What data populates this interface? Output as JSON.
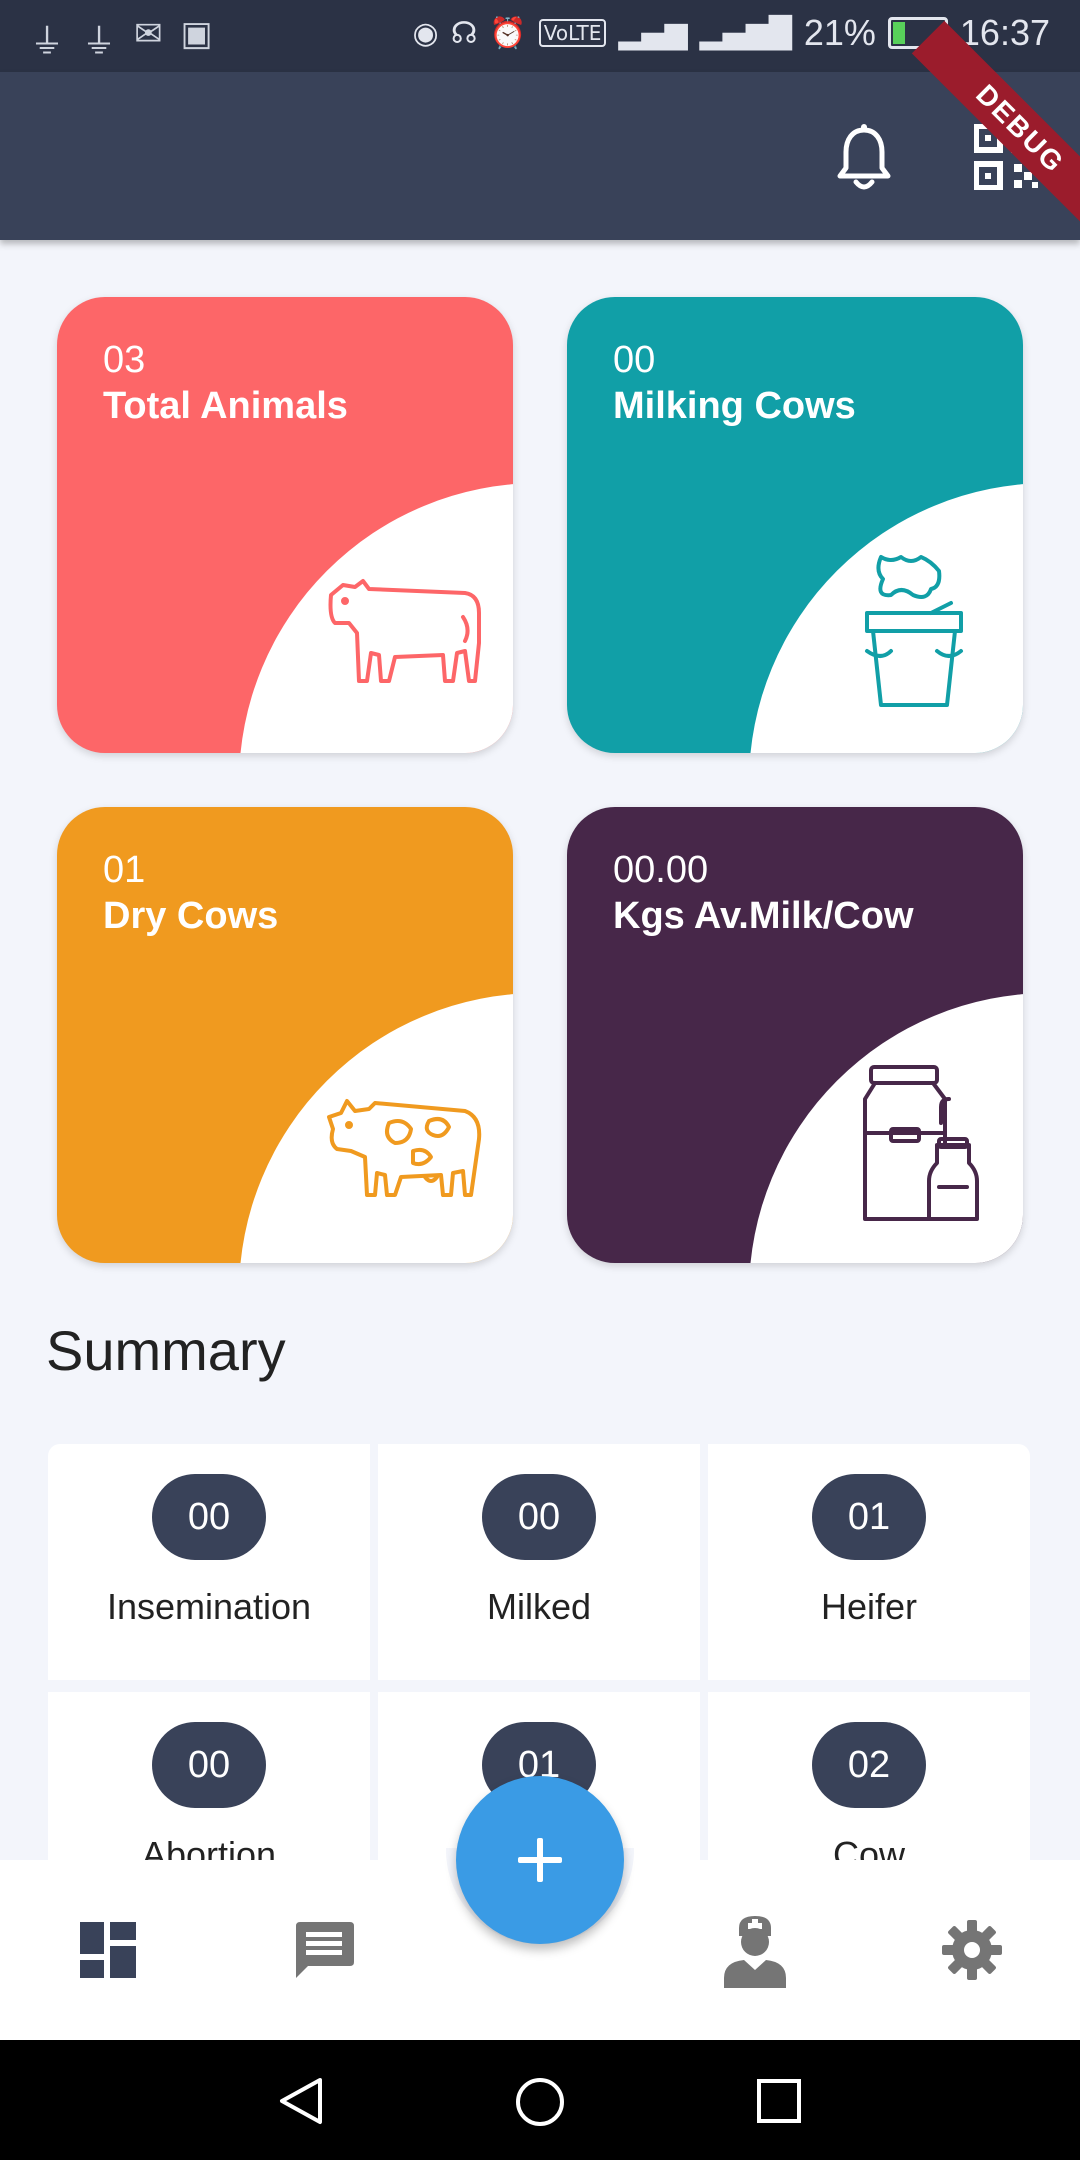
{
  "status_bar": {
    "left_icons": [
      "usb-icon",
      "usb-icon",
      "mail-icon",
      "flipboard-icon"
    ],
    "right_icons": [
      "hotspot-icon",
      "headset-icon",
      "alarm-icon",
      "volte-icon",
      "signal-2g-icon",
      "signal-4g-icon"
    ],
    "battery_percent": "21%",
    "time": "16:37"
  },
  "app_bar": {
    "debug_banner": "DEBUG",
    "actions": [
      "bell-icon",
      "qr-code-icon"
    ]
  },
  "stats": [
    {
      "value": "03",
      "label": "Total Animals",
      "color": "#fd6668",
      "icon": "cow-outline-icon"
    },
    {
      "value": "00",
      "label": "Milking Cows",
      "color": "#119fa7",
      "icon": "milk-bucket-icon"
    },
    {
      "value": "01",
      "label": "Dry Cows",
      "color": "#f09a1f",
      "icon": "spotted-cow-icon"
    },
    {
      "value": "00.00",
      "label": "Kgs Av.Milk/Cow",
      "color": "#472749",
      "icon": "milk-can-icon"
    }
  ],
  "summary": {
    "title": "Summary",
    "items": [
      {
        "count": "00",
        "label": "Insemination"
      },
      {
        "count": "00",
        "label": "Milked"
      },
      {
        "count": "01",
        "label": "Heifer"
      },
      {
        "count": "00",
        "label": "Abortion"
      },
      {
        "count": "01",
        "label": ""
      },
      {
        "count": "02",
        "label": "Cow"
      }
    ]
  },
  "bottom_nav": {
    "items": [
      "dashboard-icon",
      "message-icon",
      "add-icon",
      "doctor-icon",
      "settings-icon"
    ],
    "active_color": "#394259",
    "inactive_color": "#757575",
    "fab_color": "#3a9be5"
  }
}
